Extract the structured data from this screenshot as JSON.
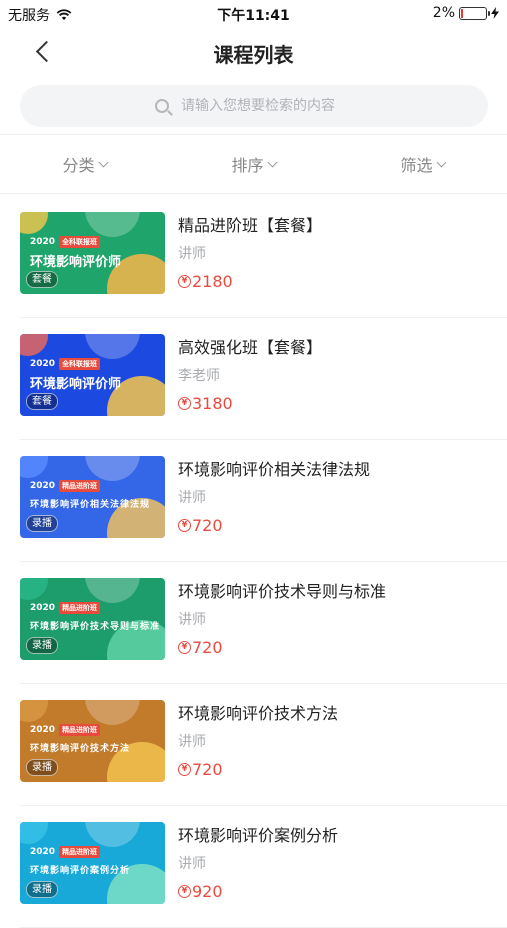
{
  "status_bar": {
    "carrier": "无服务",
    "time": "下午11:41",
    "battery": "2%"
  },
  "nav": {
    "title": "课程列表"
  },
  "search": {
    "placeholder": "请输入您想要检索的内容"
  },
  "filters": [
    "分类",
    "排序",
    "筛选"
  ],
  "courses": [
    {
      "title": "精品进阶班【套餐】",
      "teacher": "讲师",
      "price": "2180",
      "thumb": {
        "year": "2020",
        "badge": "全科联报班",
        "main": "环境影响评价师",
        "tag": "套餐",
        "small": false,
        "bg": "#1fa56b",
        "blob": "#f8b54a",
        "blob3": "#f5c84c"
      }
    },
    {
      "title": "高效强化班【套餐】",
      "teacher": "李老师",
      "price": "3180",
      "thumb": {
        "year": "2020",
        "badge": "全科联报班",
        "main": "环境影响评价师",
        "tag": "套餐",
        "small": false,
        "bg": "#1c49e0",
        "blob": "#f6c54a",
        "blob3": "#f06a5a"
      }
    },
    {
      "title": "环境影响评价相关法律法规",
      "teacher": "讲师",
      "price": "720",
      "thumb": {
        "year": "2020",
        "badge": "精品进阶班",
        "main": "环境影响评价相关法律法规",
        "tag": "录播",
        "small": true,
        "bg": "#3466e8",
        "blob": "#f0c060",
        "blob3": "#5a8cff"
      }
    },
    {
      "title": "环境影响评价技术导则与标准",
      "teacher": "讲师",
      "price": "720",
      "thumb": {
        "year": "2020",
        "badge": "精品进阶班",
        "main": "环境影响评价技术导则与标准",
        "tag": "录播",
        "small": true,
        "bg": "#1d9c6c",
        "blob": "#5fd2a5",
        "blob3": "#2bb88a"
      }
    },
    {
      "title": "环境影响评价技术方法",
      "teacher": "讲师",
      "price": "720",
      "thumb": {
        "year": "2020",
        "badge": "精品进阶班",
        "main": "环境影响评价技术方法",
        "tag": "录播",
        "small": true,
        "bg": "#c27a2b",
        "blob": "#f3c24f",
        "blob3": "#d99a45"
      }
    },
    {
      "title": "环境影响评价案例分析",
      "teacher": "讲师",
      "price": "920",
      "thumb": {
        "year": "2020",
        "badge": "精品进阶班",
        "main": "环境影响评价案例分析",
        "tag": "录播",
        "small": true,
        "bg": "#18a9d8",
        "blob": "#7de0c4",
        "blob3": "#39c2e8"
      }
    }
  ],
  "colors": {
    "price": "#e94a3f",
    "muted": "#a9abb0"
  }
}
